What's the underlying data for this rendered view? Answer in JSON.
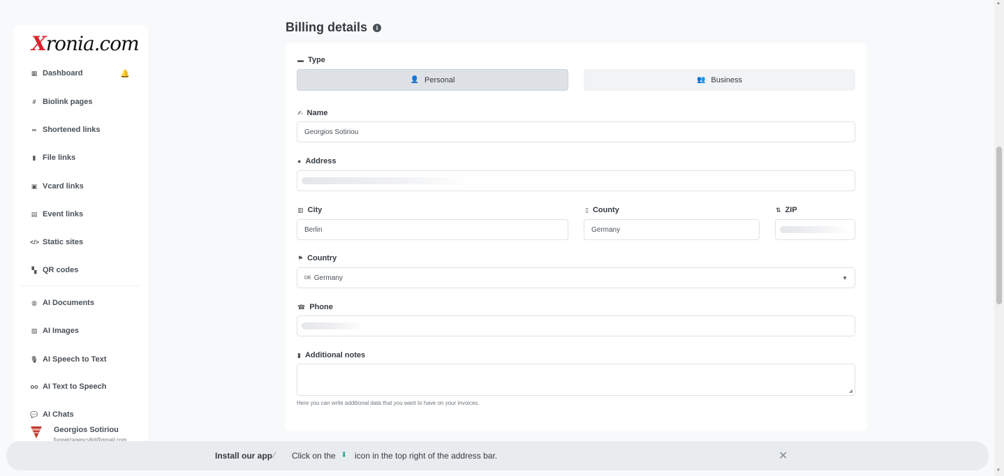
{
  "brand": {
    "logo_x": "X",
    "logo_rest": "ronia.com"
  },
  "sidebar": {
    "items": [
      {
        "label": "Dashboard",
        "icon": "table-icon"
      },
      {
        "label": "Biolink pages",
        "icon": "hash-icon"
      },
      {
        "label": "Shortened links",
        "icon": "link-icon"
      },
      {
        "label": "File links",
        "icon": "file-icon"
      },
      {
        "label": "Vcard links",
        "icon": "id-card-icon"
      },
      {
        "label": "Event links",
        "icon": "calendar-icon"
      },
      {
        "label": "Static sites",
        "icon": "code-icon"
      },
      {
        "label": "QR codes",
        "icon": "qrcode-icon"
      },
      {
        "label": "AI Documents",
        "icon": "robot-icon"
      },
      {
        "label": "AI Images",
        "icon": "image-icon"
      },
      {
        "label": "AI Speech to Text",
        "icon": "microphone-icon"
      },
      {
        "label": "AI Text to Speech",
        "icon": "voicemail-icon"
      },
      {
        "label": "AI Chats",
        "icon": "comments-icon"
      }
    ],
    "user": {
      "name": "Georgios Sotiriou",
      "email": "funnelzagencyltd@gmail.com"
    }
  },
  "billing": {
    "title": "Billing details",
    "type_label": "Type",
    "type_options": [
      "Personal",
      "Business"
    ],
    "type_selected": "Personal",
    "name_label": "Name",
    "name_value": "Georgios Sotiriou",
    "address_label": "Address",
    "city_label": "City",
    "city_value": "Berlin",
    "county_label": "County",
    "county_value": "Germany",
    "zip_label": "ZIP",
    "country_label": "Country",
    "country_flag": "DE",
    "country_value": "Germany",
    "phone_label": "Phone",
    "notes_label": "Additional notes",
    "notes_hint": "Here you can write additional data that you want to have on your invoices."
  },
  "banner": {
    "install": "Install our app",
    "click_on": "Click on the",
    "rest": "icon in the top right of the address bar."
  }
}
